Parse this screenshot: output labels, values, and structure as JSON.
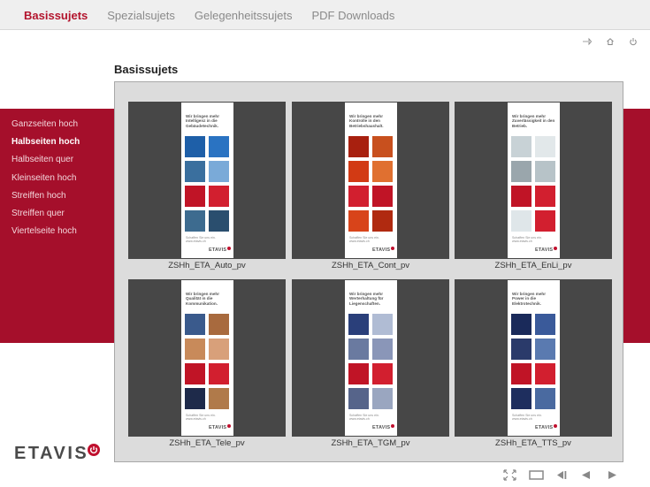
{
  "nav": {
    "items": [
      {
        "label": "Basissujets",
        "active": true
      },
      {
        "label": "Spezialsujets",
        "active": false
      },
      {
        "label": "Gelegenheitssujets",
        "active": false
      },
      {
        "label": "PDF Downloads",
        "active": false
      }
    ]
  },
  "utility_icons": [
    "print-icon",
    "home-icon",
    "power-icon"
  ],
  "sidebar": {
    "items": [
      {
        "label": "Ganzseiten hoch",
        "active": false
      },
      {
        "label": "Halbseiten hoch",
        "active": true
      },
      {
        "label": "Halbseiten quer",
        "active": false
      },
      {
        "label": "Kleinseiten hoch",
        "active": false
      },
      {
        "label": "Streiffen hoch",
        "active": false
      },
      {
        "label": "Streiffen quer",
        "active": false
      },
      {
        "label": "Viertelseite hoch",
        "active": false
      }
    ]
  },
  "main": {
    "title": "Basissujets",
    "thumbnails": [
      {
        "caption": "ZSHh_ETA_Auto_pv",
        "headline": "Wir bringen mehr Intelligenz in die Gebäudetechnik.",
        "tiles": [
          "#1e5fa8",
          "#2a73c2",
          "#3a6f9e",
          "#7aaad8",
          "#c01426",
          "#d21f2f",
          "#3d6b8f",
          "#2a4e6e"
        ]
      },
      {
        "caption": "ZSHh_ETA_Cont_pv",
        "headline": "Wir bringen mehr Kontrolle in den Betriebshaushalt.",
        "tiles": [
          "#a8200f",
          "#c8501e",
          "#d23a14",
          "#e07030",
          "#d21f2f",
          "#c01426",
          "#d8441a",
          "#b02a10"
        ]
      },
      {
        "caption": "ZSHh_ETA_EnLi_pv",
        "headline": "Wir bringen mehr Zuverlässigkeit in den Betrieb.",
        "tiles": [
          "#c8d2d6",
          "#e2e8ea",
          "#9aa6ac",
          "#b7c3c8",
          "#c01426",
          "#d21f2f",
          "#dfe6e9",
          "#d21f2f"
        ]
      },
      {
        "caption": "ZSHh_ETA_Tele_pv",
        "headline": "Wir bringen mehr Qualität in die Kommunikation.",
        "tiles": [
          "#3a5a8c",
          "#a86a3e",
          "#c88a5a",
          "#d8a07a",
          "#c01426",
          "#d21f2f",
          "#1e2a4a",
          "#b07a4a"
        ]
      },
      {
        "caption": "ZSHh_ETA_TGM_pv",
        "headline": "Wir bringen mehr Werterhaltung für Liegenschaften.",
        "tiles": [
          "#2a3f7a",
          "#b0bcd4",
          "#6a7aa0",
          "#8a96b8",
          "#c01426",
          "#d21f2f",
          "#56648a",
          "#9aa6c0"
        ]
      },
      {
        "caption": "ZSHh_ETA_TTS_pv",
        "headline": "Wir bringen mehr Power in die Elektrotechnik.",
        "tiles": [
          "#1a2a5a",
          "#3a5a9a",
          "#2a3a6a",
          "#5a7ab0",
          "#c01426",
          "#d21f2f",
          "#1e2e5e",
          "#4a6aa0"
        ]
      }
    ],
    "poster_footer": "Schaffen Sie uns ein. www.etavis.ch",
    "poster_logo": "ETAVIS"
  },
  "logo": {
    "text": "ETAVIS"
  },
  "controls": [
    "fullscreen-icon",
    "window-icon",
    "first-page-icon",
    "previous-icon",
    "next-icon"
  ],
  "colors": {
    "brand": "#a50f2b",
    "accent": "#b3142d",
    "logo_dot": "#c0102e"
  }
}
